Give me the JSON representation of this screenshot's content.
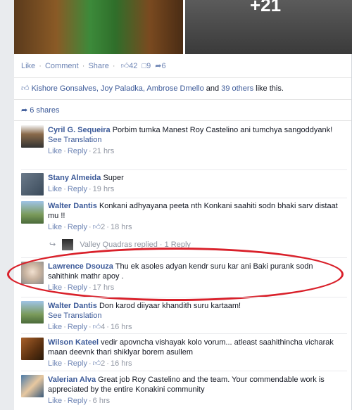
{
  "photos": {
    "more_count": "+21"
  },
  "actions": {
    "like": "Like",
    "comment": "Comment",
    "share": "Share",
    "like_count": "42",
    "comment_count": "9",
    "share_count": "6"
  },
  "likes": {
    "names": "Kishore Gonsalves, Joy Paladka, Ambrose Dmello",
    "and": " and ",
    "others": "39 others",
    "suffix": " like this."
  },
  "shares": {
    "label": "6 shares"
  },
  "comments": [
    {
      "name": "Cyril G. Sequeira",
      "text": "Porbim tumka Manest Roy Castelino ani tumchya sangoddyank!",
      "see_translation": "See Translation",
      "like": "Like",
      "reply": "Reply",
      "likes": "",
      "time": "21 hrs"
    },
    {
      "name": "Stany Almeida",
      "text": "Super",
      "see_translation": "",
      "like": "Like",
      "reply": "Reply",
      "likes": "",
      "time": "19 hrs"
    },
    {
      "name": "Walter Dantis",
      "text": "Konkani adhyayana peeta nth Konkani saahiti sodn bhaki sarv distaat mu !!",
      "see_translation": "",
      "like": "Like",
      "reply": "Reply",
      "likes": "2",
      "time": "18 hrs"
    },
    {
      "name": "Lawrence Dsouza",
      "text": "Thu ek asoles adyan kendr suru kar ani Baki purank sodn sahithink mathr apoy .",
      "see_translation": "",
      "like": "Like",
      "reply": "Reply",
      "likes": "",
      "time": "17 hrs"
    },
    {
      "name": "Walter Dantis",
      "text": "Don karod diiyaar khandith suru kartaam!",
      "see_translation": "See Translation",
      "like": "Like",
      "reply": "Reply",
      "likes": "4",
      "time": "16 hrs"
    },
    {
      "name": "Wilson Kateel",
      "text": "vedir apovncha vishayak kolo vorum... atleast saahithincha vicharak maan deevnk thari shiklyar borem asullem",
      "see_translation": "",
      "like": "Like",
      "reply": "Reply",
      "likes": "2",
      "time": "16 hrs"
    },
    {
      "name": "Valerian Alva",
      "text": "Great job Roy Castelino and the team. Your commendable work is appreciated by the entire Konakini community",
      "see_translation": "",
      "like": "Like",
      "reply": "Reply",
      "likes": "",
      "time": "6 hrs"
    }
  ],
  "reply_preview": {
    "text": "Valley Quadras replied · 1 Reply"
  },
  "colors": {
    "link": "#3b5998",
    "meta": "#9197a3",
    "highlight": "#d9202a"
  }
}
